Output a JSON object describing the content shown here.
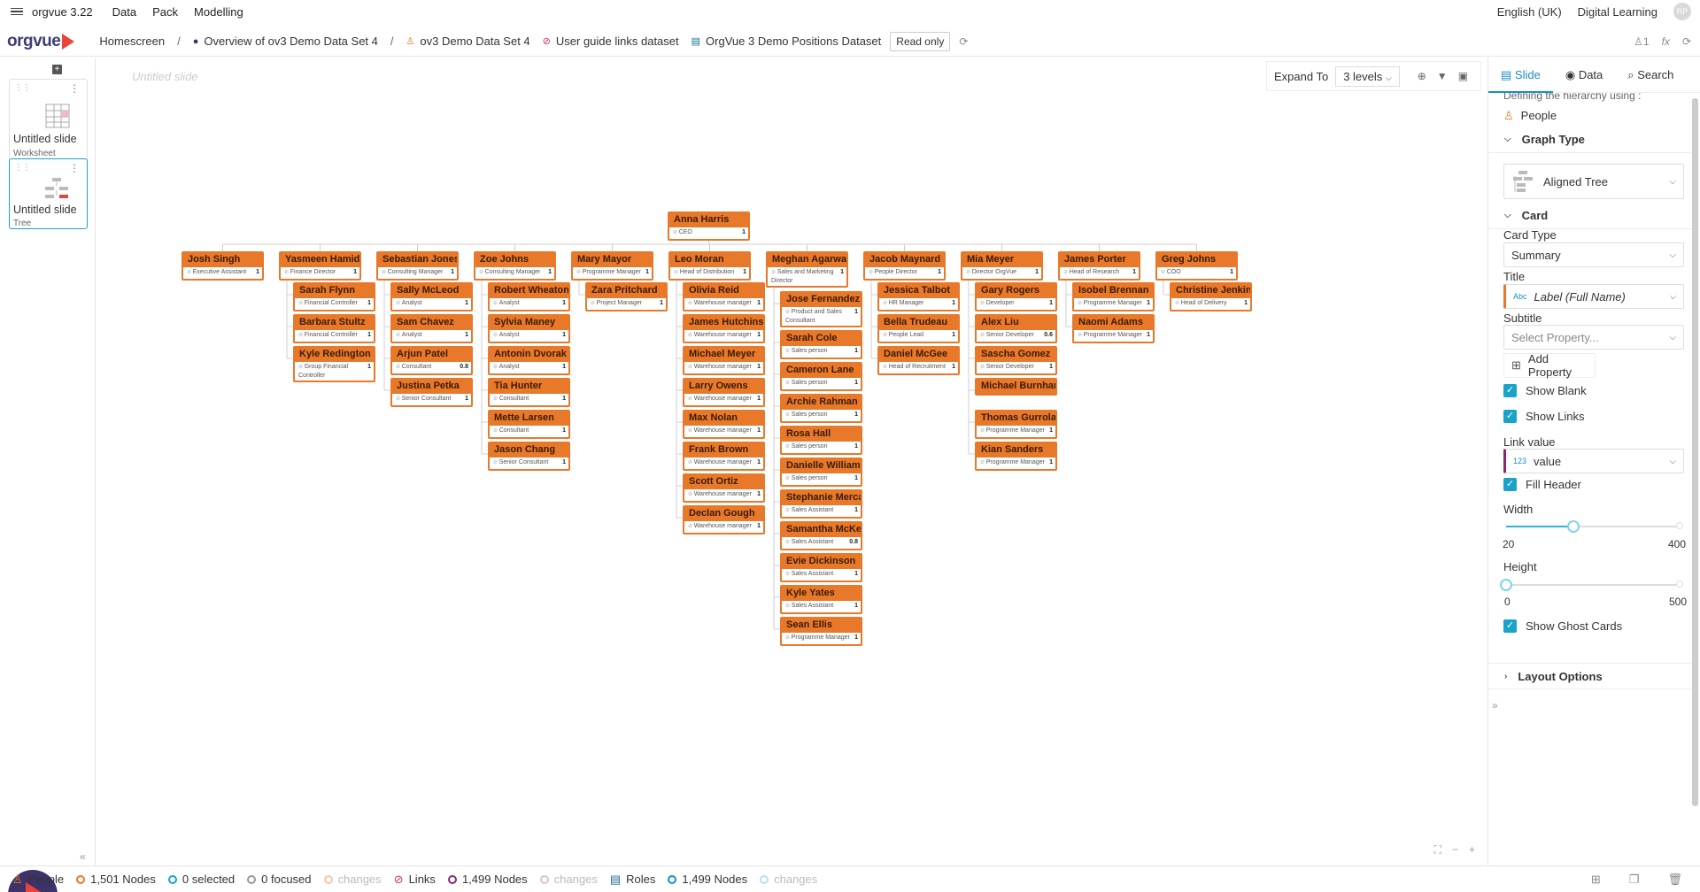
{
  "app": {
    "version": "orgvue 3.22",
    "menus": [
      "Data",
      "Pack",
      "Modelling"
    ],
    "language": "English (UK)",
    "workspace": "Digital Learning",
    "user_initials": "RP"
  },
  "breadcrumb": {
    "logo": "orgvue",
    "items": [
      "Homescreen",
      "Overview of ov3 Demo Data Set 4",
      "ov3 Demo Data Set 4",
      "User guide links dataset",
      "OrgVue 3 Demo Positions Dataset"
    ],
    "readonly": "Read only",
    "user_count": "1",
    "fx": "fx"
  },
  "slides": [
    {
      "title": "Untitled slide",
      "type": "Worksheet"
    },
    {
      "title": "Untitled slide",
      "type": "Tree"
    }
  ],
  "canvas": {
    "slide_title": "Untitled slide",
    "expand_label": "Expand To",
    "expand_value": "3 levels"
  },
  "tree": {
    "root": {
      "name": "Anna Harris",
      "role": "CEO",
      "value": "1"
    },
    "columns": [
      {
        "head": {
          "name": "Josh Singh",
          "role": "Executive Assistant",
          "value": "1"
        },
        "children": []
      },
      {
        "head": {
          "name": "Yasmeen Hamidi",
          "role": "Finance Director",
          "value": "1"
        },
        "children": [
          {
            "name": "Sarah Flynn",
            "role": "Financial Controller",
            "value": "1"
          },
          {
            "name": "Barbara Stultz",
            "role": "Financial Controller",
            "value": "1"
          },
          {
            "name": "Kyle Redington",
            "role": "Group Financial Controller",
            "value": "1"
          }
        ]
      },
      {
        "head": {
          "name": "Sebastian Jones",
          "role": "Consulting Manager",
          "value": "1"
        },
        "children": [
          {
            "name": "Sally McLeod",
            "role": "Analyst",
            "value": "1"
          },
          {
            "name": "Sam Chavez",
            "role": "Analyst",
            "value": "1"
          },
          {
            "name": "Arjun Patel",
            "role": "Consultant",
            "value": "0.8"
          },
          {
            "name": "Justina Petka",
            "role": "Senior Consultant",
            "value": "1"
          }
        ]
      },
      {
        "head": {
          "name": "Zoe Johns",
          "role": "Consulting Manager",
          "value": "1"
        },
        "children": [
          {
            "name": "Robert Wheaton",
            "role": "Analyst",
            "value": "1"
          },
          {
            "name": "Sylvia Maney",
            "role": "Analyst",
            "value": "1"
          },
          {
            "name": "Antonin Dvorak",
            "role": "Analyst",
            "value": "1"
          },
          {
            "name": "Tia Hunter",
            "role": "Consultant",
            "value": "1"
          },
          {
            "name": "Mette Larsen",
            "role": "Consultant",
            "value": "1"
          },
          {
            "name": "Jason Chang",
            "role": "Senior Consultant",
            "value": "1"
          }
        ]
      },
      {
        "head": {
          "name": "Mary Mayor",
          "role": "Programme Manager",
          "value": "1"
        },
        "children": [
          {
            "name": "Zara Pritchard",
            "role": "Project Manager",
            "value": "1"
          }
        ]
      },
      {
        "head": {
          "name": "Leo Moran",
          "role": "Head of Distribution",
          "value": "1"
        },
        "children": [
          {
            "name": "Olivia Reid",
            "role": "Warehouse manager",
            "value": "1"
          },
          {
            "name": "James Hutchinson",
            "role": "Warehouse manager",
            "value": "1"
          },
          {
            "name": "Michael Meyer",
            "role": "Warehouse manager",
            "value": "1"
          },
          {
            "name": "Larry Owens",
            "role": "Warehouse manager",
            "value": "1"
          },
          {
            "name": "Max Nolan",
            "role": "Warehouse manager",
            "value": "1"
          },
          {
            "name": "Frank Brown",
            "role": "Warehouse manager",
            "value": "1"
          },
          {
            "name": "Scott Ortiz",
            "role": "Warehouse manager",
            "value": "1"
          },
          {
            "name": "Declan Gough",
            "role": "Warehouse manager",
            "value": "1"
          }
        ]
      },
      {
        "head": {
          "name": "Meghan Agarwal",
          "role": "Sales and Marketing Director",
          "value": "1"
        },
        "children": [
          {
            "name": "Jose Fernandez",
            "role": "Product and Sales Consultant",
            "value": "1"
          },
          {
            "name": "Sarah Cole",
            "role": "Sales person",
            "value": "1"
          },
          {
            "name": "Cameron Lane",
            "role": "Sales person",
            "value": "1"
          },
          {
            "name": "Archie Rahman",
            "role": "Sales person",
            "value": "1"
          },
          {
            "name": "Rosa Hall",
            "role": "Sales person",
            "value": "1"
          },
          {
            "name": "Danielle Williams",
            "role": "Sales person",
            "value": "1"
          },
          {
            "name": "Stephanie Mercado",
            "role": "Sales Assistant",
            "value": "1"
          },
          {
            "name": "Samantha McKenzie",
            "role": "Sales Assistant",
            "value": "0.8"
          },
          {
            "name": "Evie Dickinson",
            "role": "Sales Assistant",
            "value": "1"
          },
          {
            "name": "Kyle Yates",
            "role": "Sales Assistant",
            "value": "1"
          },
          {
            "name": "Sean Ellis",
            "role": "Programme Manager",
            "value": "1"
          }
        ]
      },
      {
        "head": {
          "name": "Jacob Maynard",
          "role": "People Director",
          "value": "1"
        },
        "children": [
          {
            "name": "Jessica Talbot",
            "role": "HR Manager",
            "value": "1"
          },
          {
            "name": "Bella Trudeau",
            "role": "People Lead",
            "value": "1"
          },
          {
            "name": "Daniel McGee",
            "role": "Head of Recruitment",
            "value": "1"
          }
        ]
      },
      {
        "head": {
          "name": "Mia Meyer",
          "role": "Director OrgVue",
          "value": "1"
        },
        "children": [
          {
            "name": "Gary Rogers",
            "role": "Developer",
            "value": "1"
          },
          {
            "name": "Alex Liu",
            "role": "Senior Developer",
            "value": "0.6"
          },
          {
            "name": "Sascha Gomez",
            "role": "Senior Developer",
            "value": "1"
          },
          {
            "name": "Michael Burnham",
            "role": "",
            "value": ""
          },
          {
            "name": "Thomas Gurrola",
            "role": "Programme Manager",
            "value": "1"
          },
          {
            "name": "Kian Sanders",
            "role": "Programme Manager",
            "value": "1"
          }
        ]
      },
      {
        "head": {
          "name": "James Porter",
          "role": "Head of Research",
          "value": "1"
        },
        "children": [
          {
            "name": "Isobel Brennan",
            "role": "Programme Manager",
            "value": "1"
          },
          {
            "name": "Naomi Adams",
            "role": "Programme Manager",
            "value": "1"
          }
        ]
      },
      {
        "head": {
          "name": "Greg Johns",
          "role": "COO",
          "value": "1"
        },
        "children": [
          {
            "name": "Christine Jenkins",
            "role": "Head of Delivery",
            "value": "1"
          }
        ]
      }
    ]
  },
  "panel": {
    "tabs": [
      "Slide",
      "Data",
      "Search"
    ],
    "hierarchy_text": "Defining the hierarchy using :",
    "hierarchy_value": "People",
    "graph_type_head": "Graph Type",
    "graph_type": "Aligned Tree",
    "card_head": "Card",
    "card_type_label": "Card Type",
    "card_type": "Summary",
    "title_label": "Title",
    "title_tag": "Abc",
    "title_value": "Label (Full Name)",
    "subtitle_label": "Subtitle",
    "subtitle_placeholder": "Select Property...",
    "add_property": "Add Property",
    "show_blank": "Show Blank",
    "show_links": "Show Links",
    "link_value_label": "Link value",
    "link_value_tag": "123",
    "link_value": "value",
    "fill_header": "Fill Header",
    "width_label": "Width",
    "width_min": "20",
    "width_max": "400",
    "width_fraction": 0.39,
    "height_label": "Height",
    "height_min": "0",
    "height_max": "500",
    "height_fraction": 0.0,
    "show_ghost": "Show Ghost Cards",
    "layout_head": "Layout Options"
  },
  "status": {
    "people": "People",
    "people_nodes": "1,501 Nodes",
    "selected": "0 selected",
    "focused": "0 focused",
    "changes": "changes",
    "links": "Links",
    "links_nodes": "1,499 Nodes",
    "roles": "Roles",
    "roles_nodes": "1,499 Nodes"
  },
  "colors": {
    "card": "#e8792a",
    "accent": "#1aa3c9",
    "brand": "#3d3368",
    "brand_red": "#e9443a"
  }
}
